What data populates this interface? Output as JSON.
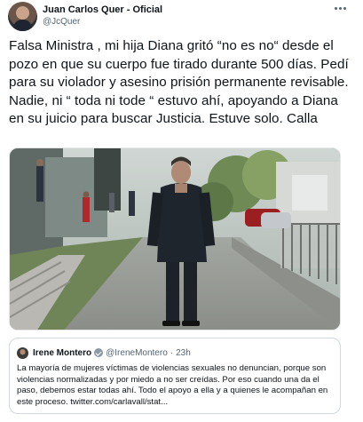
{
  "author": {
    "display_name": "Juan Carlos Quer - Oficial",
    "handle": "@JcQuer"
  },
  "tweet": {
    "text": "Falsa Ministra , mi hija Diana gritó “no es no“ desde el pozo en que su cuerpo fue tirado durante 500 días. Pedí para su violador y asesino prisión permanente revisable. Nadie, ni “ toda ni tode “ estuvo ahí, apoyando a Diana en su juicio para buscar Justicia. Estuve solo. Calla"
  },
  "quoted_tweet": {
    "display_name": "Irene Montero",
    "handle": "@IreneMontero",
    "separator": "·",
    "time": "23h",
    "text": "La mayoría de mujeres víctimas de violencias sexuales no denuncian, porque son violencias normalizadas y por miedo a no ser creídas. Por eso cuando una da el paso, debemos estar todas ahí. Todo el apoyo a ella y a quienes le acompañan en este proceso. twitter.com/carlavall/stat..."
  },
  "icons": {
    "more": "more-horizontal-icon",
    "verified": "verified-badge-icon"
  },
  "colors": {
    "text": "#0f1419",
    "secondary_text": "#536471",
    "border": "#cfd9de",
    "verified_badge": "#8b98a5"
  }
}
